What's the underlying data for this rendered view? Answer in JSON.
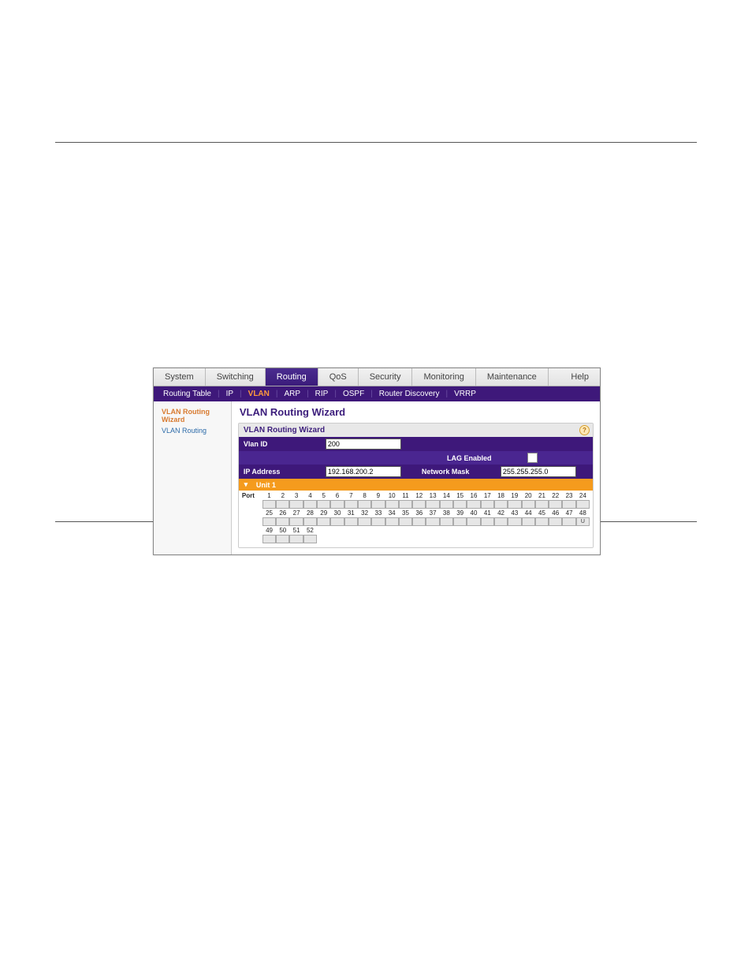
{
  "topnav": {
    "tabs": [
      "System",
      "Switching",
      "Routing",
      "QoS",
      "Security",
      "Monitoring",
      "Maintenance",
      "Help"
    ],
    "active": "Routing"
  },
  "subnav": {
    "items": [
      "Routing Table",
      "IP",
      "VLAN",
      "ARP",
      "RIP",
      "OSPF",
      "Router Discovery",
      "VRRP"
    ],
    "active": "VLAN"
  },
  "sidebar": {
    "items": [
      {
        "label": "VLAN Routing Wizard",
        "active": true
      },
      {
        "label": "VLAN Routing",
        "active": false
      }
    ]
  },
  "content": {
    "title": "VLAN Routing Wizard",
    "section_title": "VLAN Routing Wizard",
    "vlan_id_label": "Vlan ID",
    "vlan_id_value": "200",
    "lag_label": "LAG Enabled",
    "ip_label": "IP Address",
    "ip_value": "192.168.200.2",
    "mask_label": "Network Mask",
    "mask_value": "255.255.255.0",
    "unit_label": "Unit 1",
    "port_label": "Port",
    "port_rows": [
      {
        "start": 1,
        "end": 24,
        "u_index": null
      },
      {
        "start": 25,
        "end": 48,
        "u_index": 48
      },
      {
        "start": 49,
        "end": 52,
        "u_index": null
      }
    ]
  }
}
